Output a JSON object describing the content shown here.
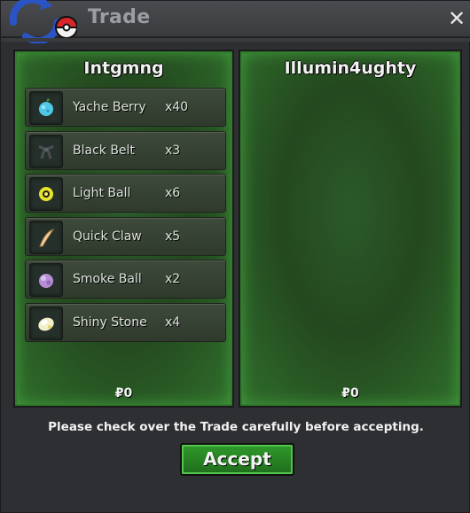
{
  "window": {
    "title": "Trade",
    "close_label": "✕"
  },
  "left_panel": {
    "player_name": "Intgmng",
    "money": "₽0",
    "items": [
      {
        "name": "Yache Berry",
        "qty": "x40",
        "icon": "yache-berry-icon"
      },
      {
        "name": "Black Belt",
        "qty": "x3",
        "icon": "black-belt-icon"
      },
      {
        "name": "Light Ball",
        "qty": "x6",
        "icon": "light-ball-icon"
      },
      {
        "name": "Quick Claw",
        "qty": "x5",
        "icon": "quick-claw-icon"
      },
      {
        "name": "Smoke Ball",
        "qty": "x2",
        "icon": "smoke-ball-icon"
      },
      {
        "name": "Shiny Stone",
        "qty": "x4",
        "icon": "shiny-stone-icon"
      }
    ]
  },
  "right_panel": {
    "player_name": "Illumin4ughty",
    "money": "₽0",
    "items": []
  },
  "footer": {
    "notice": "Please check over the Trade carefully before accepting.",
    "accept_label": "Accept"
  },
  "colors": {
    "panel_green": "#2f7c2b",
    "accept_green": "#2f9a2b",
    "window_bg": "#2e2f32"
  }
}
